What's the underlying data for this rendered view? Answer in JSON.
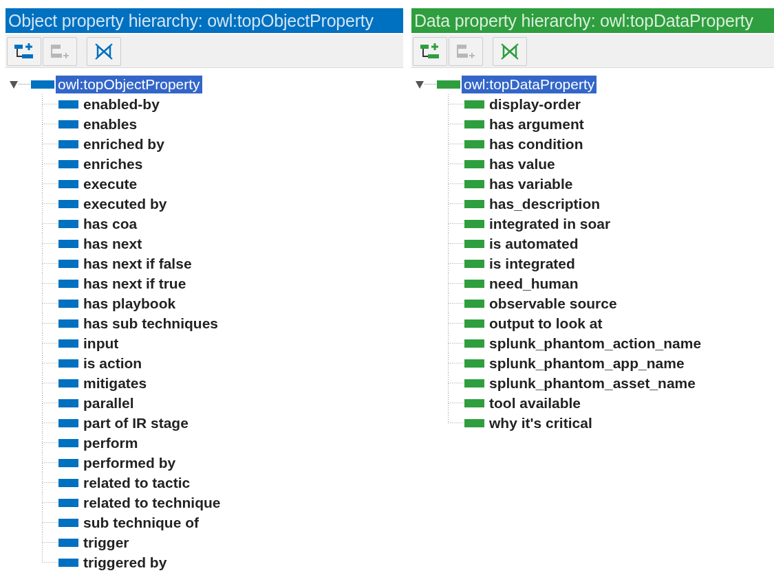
{
  "panels": [
    {
      "title": "Object property hierarchy: owl:topObjectProperty",
      "color": "#0070c0",
      "toolbar": [
        {
          "kind": "add-sub",
          "disabled": false
        },
        {
          "kind": "add-sibling",
          "disabled": true
        },
        {
          "kind": "delete",
          "disabled": false
        }
      ],
      "tree": {
        "label": "owl:topObjectProperty",
        "selected": true,
        "expanded": true,
        "children": [
          {
            "label": "enabled-by",
            "selected": false
          },
          {
            "label": "enables",
            "selected": false
          },
          {
            "label": "enriched by",
            "selected": false
          },
          {
            "label": "enriches",
            "selected": false
          },
          {
            "label": "execute",
            "selected": false
          },
          {
            "label": "executed by",
            "selected": false
          },
          {
            "label": "has coa",
            "selected": false
          },
          {
            "label": "has next",
            "selected": false
          },
          {
            "label": "has next if false",
            "selected": false
          },
          {
            "label": "has next if true",
            "selected": false
          },
          {
            "label": "has playbook",
            "selected": false
          },
          {
            "label": "has sub techniques",
            "selected": false
          },
          {
            "label": "input",
            "selected": false
          },
          {
            "label": "is action",
            "selected": false
          },
          {
            "label": "mitigates",
            "selected": false
          },
          {
            "label": "parallel",
            "selected": false
          },
          {
            "label": "part of IR stage",
            "selected": false
          },
          {
            "label": "perform",
            "selected": false
          },
          {
            "label": "performed by",
            "selected": false
          },
          {
            "label": "related to tactic",
            "selected": false
          },
          {
            "label": "related to technique",
            "selected": false
          },
          {
            "label": "sub technique of",
            "selected": false
          },
          {
            "label": "trigger",
            "selected": false
          },
          {
            "label": "triggered by",
            "selected": false
          }
        ]
      }
    },
    {
      "title": "Data property hierarchy: owl:topDataProperty",
      "color": "#2e9e3e",
      "toolbar": [
        {
          "kind": "add-sub",
          "disabled": false
        },
        {
          "kind": "add-sibling",
          "disabled": true
        },
        {
          "kind": "delete",
          "disabled": false
        }
      ],
      "tree": {
        "label": "owl:topDataProperty",
        "selected": true,
        "expanded": true,
        "children": [
          {
            "label": "display-order",
            "selected": false
          },
          {
            "label": "has argument",
            "selected": false
          },
          {
            "label": "has condition",
            "selected": false
          },
          {
            "label": "has value",
            "selected": false
          },
          {
            "label": "has variable",
            "selected": false
          },
          {
            "label": "has_description",
            "selected": false
          },
          {
            "label": "integrated in soar",
            "selected": false
          },
          {
            "label": "is automated",
            "selected": false
          },
          {
            "label": "is integrated",
            "selected": false
          },
          {
            "label": "need_human",
            "selected": false
          },
          {
            "label": "observable source",
            "selected": false
          },
          {
            "label": "output to look at",
            "selected": false
          },
          {
            "label": "splunk_phantom_action_name",
            "selected": false
          },
          {
            "label": "splunk_phantom_app_name",
            "selected": false
          },
          {
            "label": "splunk_phantom_asset_name",
            "selected": false
          },
          {
            "label": "tool available",
            "selected": false
          },
          {
            "label": "why it's critical",
            "selected": false
          }
        ]
      }
    }
  ]
}
